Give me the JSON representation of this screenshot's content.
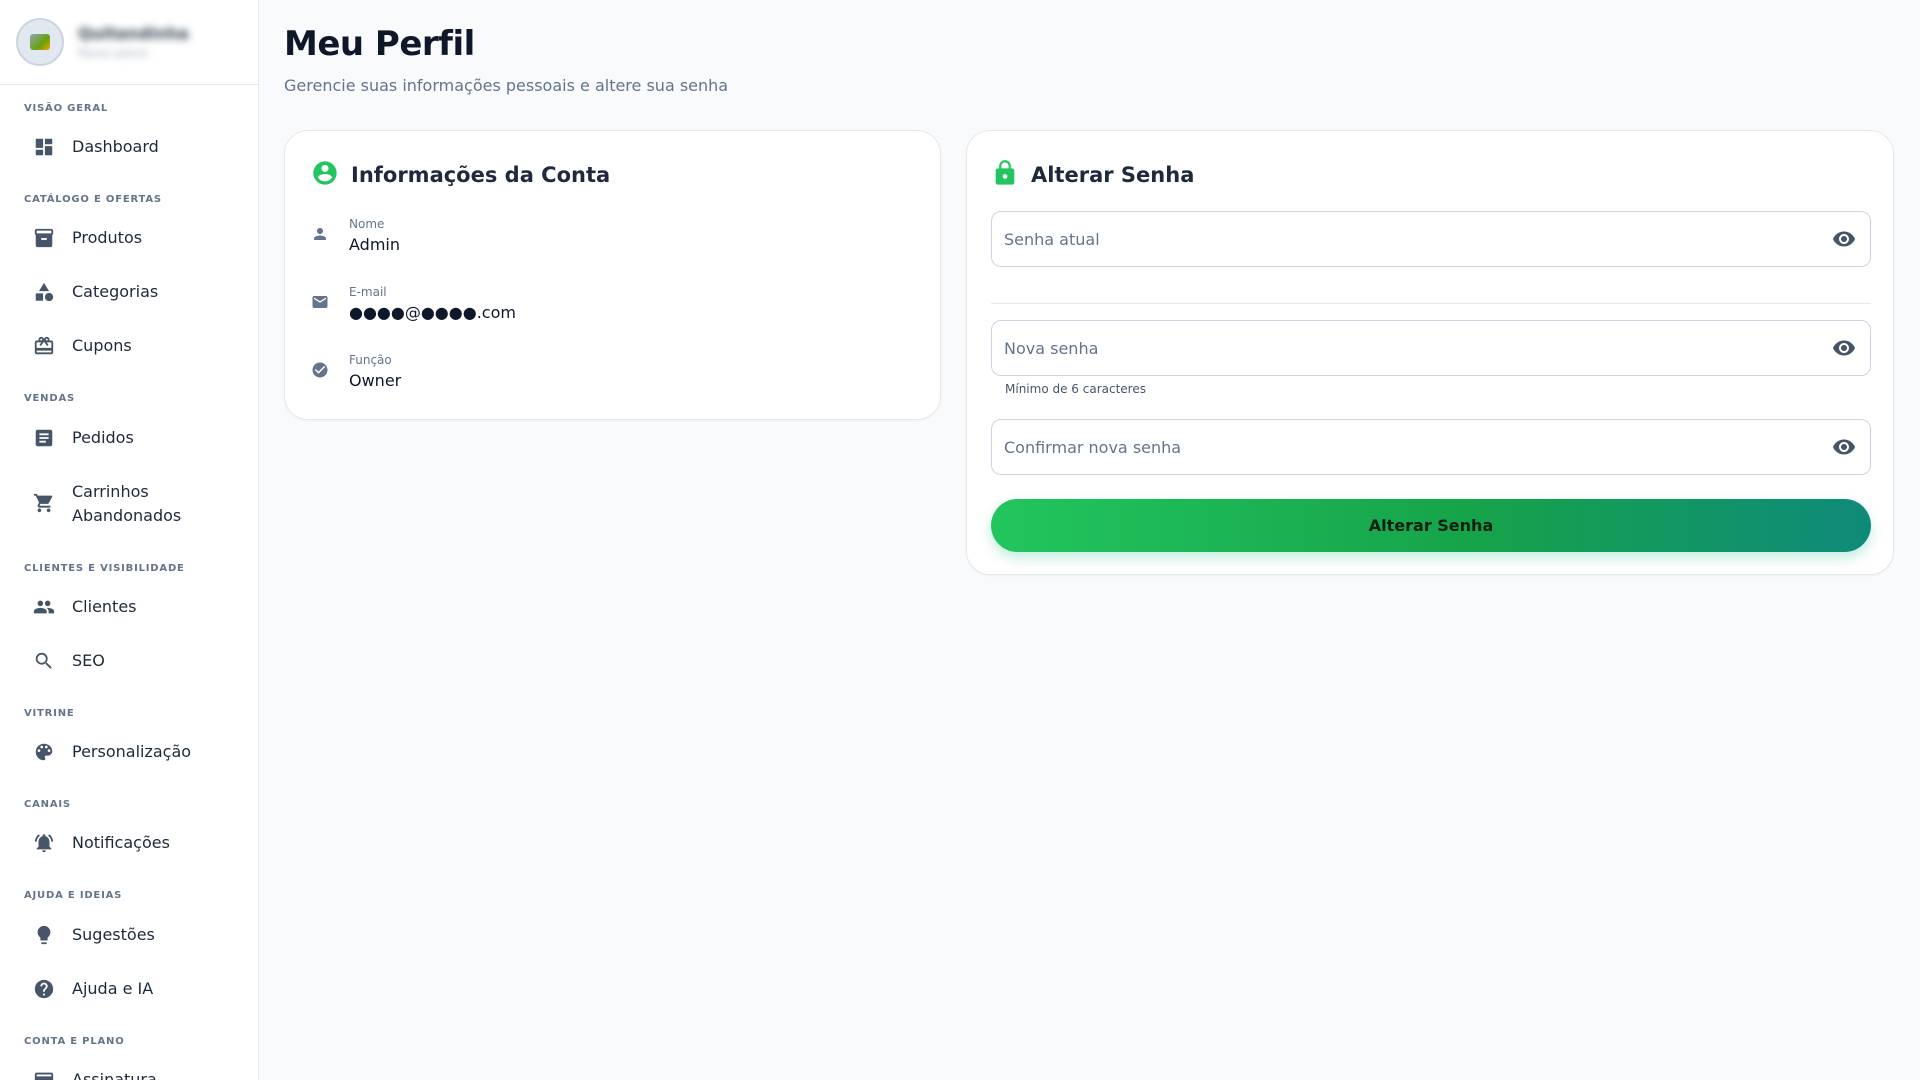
{
  "sidebar": {
    "profile": {
      "name": "Quitandinha",
      "subtitle": "Painel admin"
    },
    "sections": [
      {
        "title": "Visão geral"
      },
      {
        "title": "Catálogo e ofertas"
      },
      {
        "title": "Vendas"
      },
      {
        "title": "Clientes e visibilidade"
      },
      {
        "title": "Vitrine"
      },
      {
        "title": "Canais"
      },
      {
        "title": "Ajuda e ideias"
      },
      {
        "title": "Conta e plano"
      }
    ],
    "items": [
      {
        "label": "Dashboard",
        "icon": "dashboard-icon"
      },
      {
        "label": "Produtos",
        "icon": "archive-icon"
      },
      {
        "label": "Categorias",
        "icon": "shapes-icon"
      },
      {
        "label": "Cupons",
        "icon": "gift-card-icon"
      },
      {
        "label": "Pedidos",
        "icon": "receipt-list-icon"
      },
      {
        "label": "Carrinhos",
        "label2": "Abandonados",
        "icon": "cart-icon"
      },
      {
        "label": "Clientes",
        "icon": "people-icon"
      },
      {
        "label": "SEO",
        "icon": "search-icon"
      },
      {
        "label": "Personalização",
        "icon": "palette-icon"
      },
      {
        "label": "Notificações",
        "icon": "bell-icon"
      },
      {
        "label": "Sugestões",
        "icon": "lightbulb-icon"
      },
      {
        "label": "Ajuda e IA",
        "icon": "help-icon"
      },
      {
        "label": "Assinatura",
        "icon": "credit-card-icon"
      }
    ]
  },
  "main": {
    "title": "Meu Perfil",
    "subtitle": "Gerencie suas informações pessoais e altere sua senha"
  },
  "account": {
    "title": "Informações da Conta",
    "fields": [
      {
        "label": "Nome",
        "value": "Admin",
        "icon": "person-icon"
      },
      {
        "label": "E-mail",
        "value": "●●●●@●●●●.com",
        "icon": "mail-icon"
      },
      {
        "label": "Função",
        "value": "Owner",
        "icon": "verified-icon"
      }
    ]
  },
  "password": {
    "title": "Alterar Senha",
    "current_placeholder": "Senha atual",
    "new_placeholder": "Nova senha",
    "hint": "Mínimo de 6 caracteres",
    "confirm_placeholder": "Confirmar nova senha",
    "submit_label": "Alterar Senha"
  },
  "colors": {
    "accent": "#22c55e",
    "accent_dark": "#0f8a7a",
    "background": "#f8fafc"
  }
}
